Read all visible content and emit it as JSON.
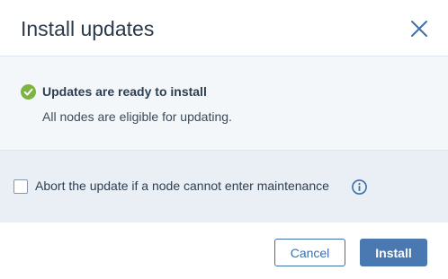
{
  "dialog": {
    "title": "Install updates",
    "close_icon": "close-icon"
  },
  "status": {
    "icon": "check-circle-icon",
    "icon_color": "#7cb342",
    "title": "Updates are ready to install",
    "description": "All nodes are eligible for updating."
  },
  "option": {
    "checked": false,
    "label": "Abort the update if a node cannot enter maintenance",
    "info_icon": "info-icon",
    "info_color": "#3e6fa8"
  },
  "footer": {
    "cancel_label": "Cancel",
    "install_label": "Install",
    "primary_color": "#4a78b0"
  }
}
